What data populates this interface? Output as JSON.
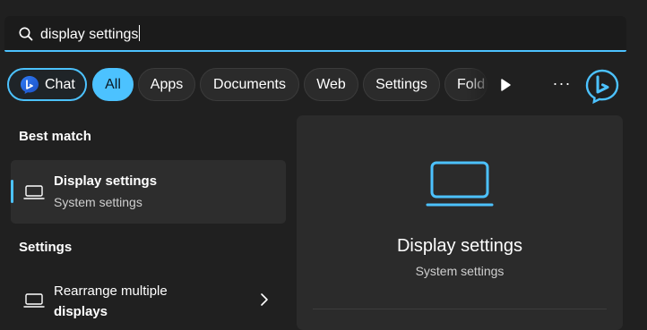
{
  "search": {
    "query": "display settings",
    "icon": "search-icon"
  },
  "filters": {
    "chat": "Chat",
    "all": "All",
    "apps": "Apps",
    "documents": "Documents",
    "web": "Web",
    "settings": "Settings",
    "folders_truncated": "Fold"
  },
  "toolbar": {
    "more": "···"
  },
  "results": {
    "best_match_label": "Best match",
    "best": {
      "title": "Display settings",
      "subtitle": "System settings"
    },
    "settings_label": "Settings",
    "items": [
      {
        "title_line1": "Rearrange multiple",
        "title_line2": "displays"
      }
    ]
  },
  "preview": {
    "title": "Display settings",
    "subtitle": "System settings"
  },
  "colors": {
    "accent": "#4cc2ff",
    "background": "#202020",
    "panel": "#2b2b2b",
    "selected": "#2d2d2d"
  }
}
